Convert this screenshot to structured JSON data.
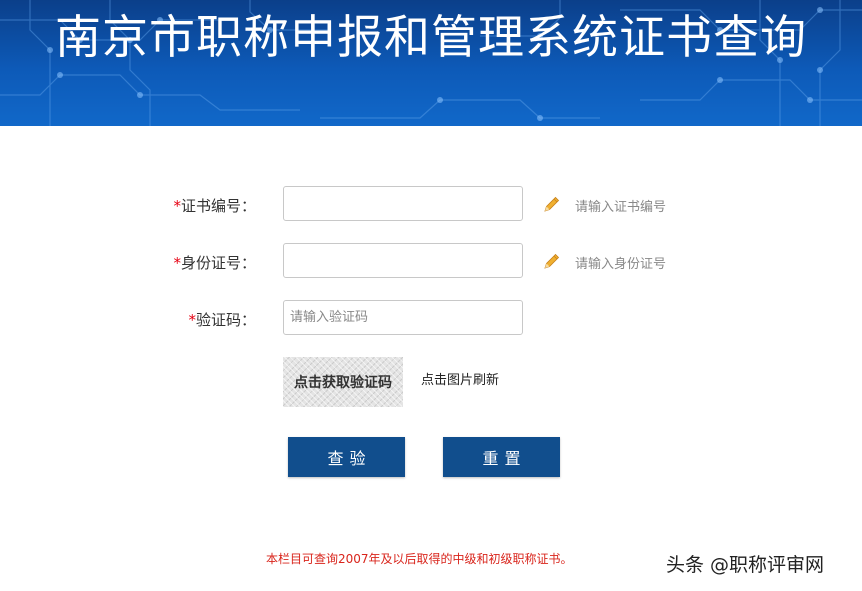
{
  "header": {
    "title": "南京市职称申报和管理系统证书查询"
  },
  "form": {
    "required_mark": "*",
    "certificate": {
      "label": "证书编号：",
      "value": "",
      "hint": "请输入证书编号"
    },
    "id_number": {
      "label": "身份证号：",
      "value": "",
      "hint": "请输入身份证号"
    },
    "captcha": {
      "label": "验证码：",
      "value": "",
      "placeholder": "请输入验证码",
      "image_text": "点击获取验证码",
      "refresh_text": "点击图片刷新"
    },
    "buttons": {
      "query": "查验",
      "reset": "重置"
    }
  },
  "notice": "本栏目可查询2007年及以后取得的中级和初级职称证书。",
  "watermark": "头条 @职称评审网",
  "colors": {
    "banner": "#0d5ab8",
    "button": "#114e8d",
    "required": "#e60012",
    "notice": "#d9251c",
    "pencil": "#e8a020"
  },
  "icons": {
    "hint": "pencil-icon"
  }
}
